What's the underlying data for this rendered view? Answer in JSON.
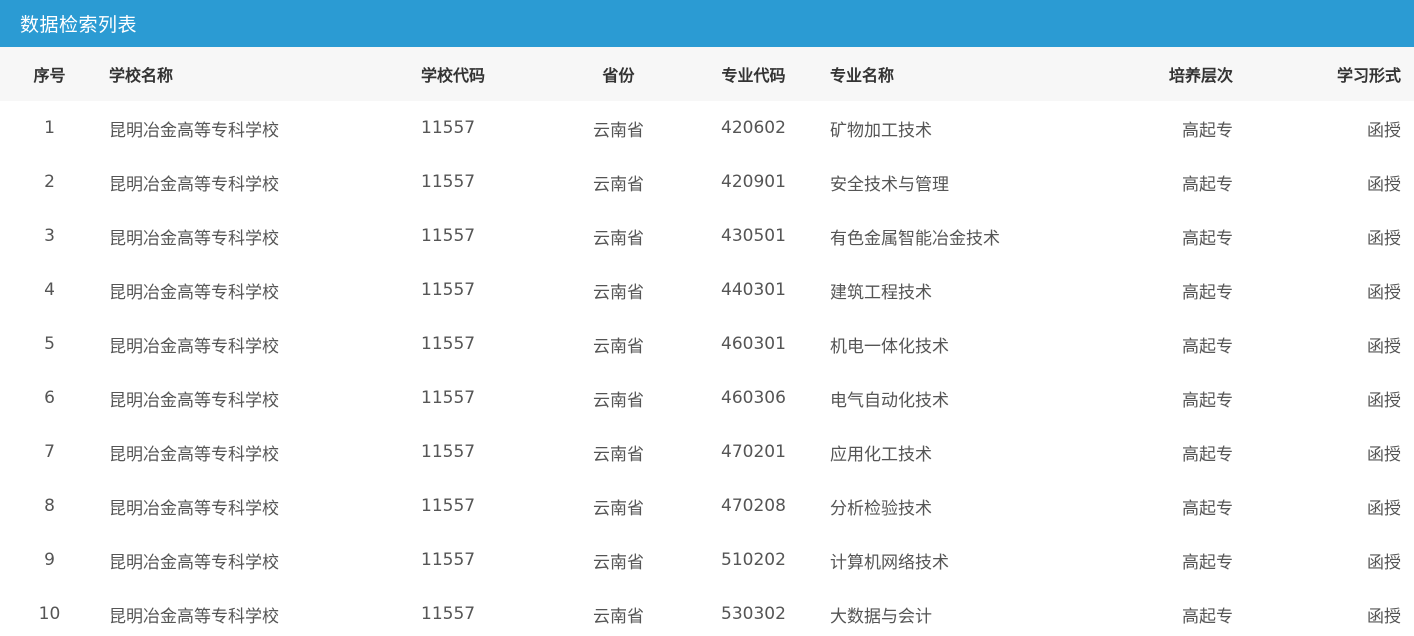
{
  "panel": {
    "title": "数据检索列表"
  },
  "table": {
    "headers": {
      "index": "序号",
      "school_name": "学校名称",
      "school_code": "学校代码",
      "province": "省份",
      "major_code": "专业代码",
      "major_name": "专业名称",
      "level": "培养层次",
      "study_mode": "学习形式"
    },
    "rows": [
      {
        "index": "1",
        "school_name": "昆明冶金高等专科学校",
        "school_code": "11557",
        "province": "云南省",
        "major_code": "420602",
        "major_name": "矿物加工技术",
        "level": "高起专",
        "study_mode": "函授"
      },
      {
        "index": "2",
        "school_name": "昆明冶金高等专科学校",
        "school_code": "11557",
        "province": "云南省",
        "major_code": "420901",
        "major_name": "安全技术与管理",
        "level": "高起专",
        "study_mode": "函授"
      },
      {
        "index": "3",
        "school_name": "昆明冶金高等专科学校",
        "school_code": "11557",
        "province": "云南省",
        "major_code": "430501",
        "major_name": "有色金属智能冶金技术",
        "level": "高起专",
        "study_mode": "函授"
      },
      {
        "index": "4",
        "school_name": "昆明冶金高等专科学校",
        "school_code": "11557",
        "province": "云南省",
        "major_code": "440301",
        "major_name": "建筑工程技术",
        "level": "高起专",
        "study_mode": "函授"
      },
      {
        "index": "5",
        "school_name": "昆明冶金高等专科学校",
        "school_code": "11557",
        "province": "云南省",
        "major_code": "460301",
        "major_name": "机电一体化技术",
        "level": "高起专",
        "study_mode": "函授"
      },
      {
        "index": "6",
        "school_name": "昆明冶金高等专科学校",
        "school_code": "11557",
        "province": "云南省",
        "major_code": "460306",
        "major_name": "电气自动化技术",
        "level": "高起专",
        "study_mode": "函授"
      },
      {
        "index": "7",
        "school_name": "昆明冶金高等专科学校",
        "school_code": "11557",
        "province": "云南省",
        "major_code": "470201",
        "major_name": "应用化工技术",
        "level": "高起专",
        "study_mode": "函授"
      },
      {
        "index": "8",
        "school_name": "昆明冶金高等专科学校",
        "school_code": "11557",
        "province": "云南省",
        "major_code": "470208",
        "major_name": "分析检验技术",
        "level": "高起专",
        "study_mode": "函授"
      },
      {
        "index": "9",
        "school_name": "昆明冶金高等专科学校",
        "school_code": "11557",
        "province": "云南省",
        "major_code": "510202",
        "major_name": "计算机网络技术",
        "level": "高起专",
        "study_mode": "函授"
      },
      {
        "index": "10",
        "school_name": "昆明冶金高等专科学校",
        "school_code": "11557",
        "province": "云南省",
        "major_code": "530302",
        "major_name": "大数据与会计",
        "level": "高起专",
        "study_mode": "函授"
      }
    ]
  }
}
